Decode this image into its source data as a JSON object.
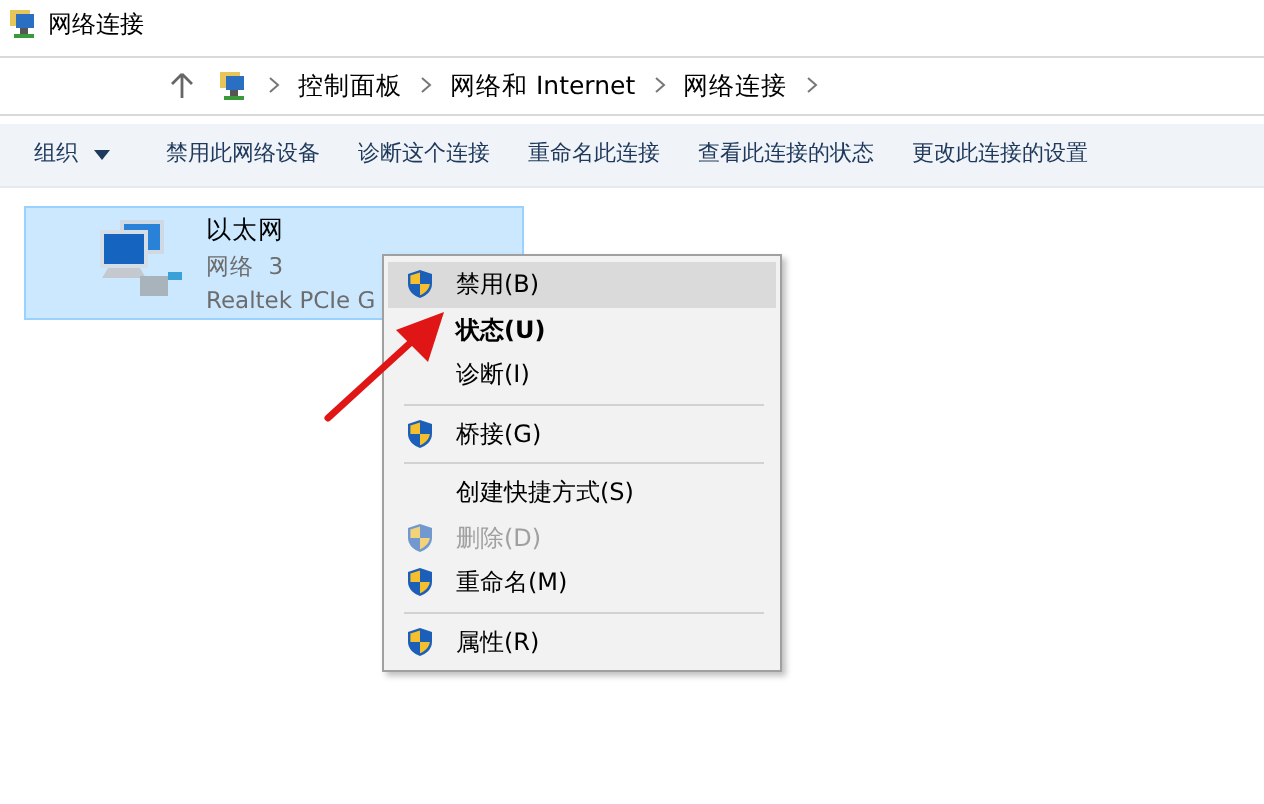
{
  "window": {
    "title": "网络连接"
  },
  "address_bar": {
    "crumbs": [
      "控制面板",
      "网络和 Internet",
      "网络连接"
    ]
  },
  "toolbar": [
    {
      "label": "组织",
      "dropdown": true
    },
    {
      "label": "禁用此网络设备",
      "dropdown": false
    },
    {
      "label": "诊断这个连接",
      "dropdown": false
    },
    {
      "label": "重命名此连接",
      "dropdown": false
    },
    {
      "label": "查看此连接的状态",
      "dropdown": false
    },
    {
      "label": "更改此连接的设置",
      "dropdown": false
    }
  ],
  "connections": [
    {
      "name": "以太网",
      "network": "网络  3",
      "adapter": "Realtek PCIe G",
      "selected": true
    }
  ],
  "context_menu": [
    {
      "kind": "item",
      "label": "禁用(B)",
      "shield": true,
      "bold": false,
      "disabled": false,
      "selected": true
    },
    {
      "kind": "item",
      "label": "状态(U)",
      "shield": false,
      "bold": true,
      "disabled": false,
      "selected": false
    },
    {
      "kind": "item",
      "label": "诊断(I)",
      "shield": false,
      "bold": false,
      "disabled": false,
      "selected": false
    },
    {
      "kind": "separator"
    },
    {
      "kind": "item",
      "label": "桥接(G)",
      "shield": true,
      "bold": false,
      "disabled": false,
      "selected": false
    },
    {
      "kind": "separator"
    },
    {
      "kind": "item",
      "label": "创建快捷方式(S)",
      "shield": false,
      "bold": false,
      "disabled": false,
      "selected": false
    },
    {
      "kind": "item",
      "label": "删除(D)",
      "shield": true,
      "bold": false,
      "disabled": true,
      "selected": false
    },
    {
      "kind": "item",
      "label": "重命名(M)",
      "shield": true,
      "bold": false,
      "disabled": false,
      "selected": false
    },
    {
      "kind": "separator"
    },
    {
      "kind": "item",
      "label": "属性(R)",
      "shield": true,
      "bold": false,
      "disabled": false,
      "selected": false
    }
  ]
}
